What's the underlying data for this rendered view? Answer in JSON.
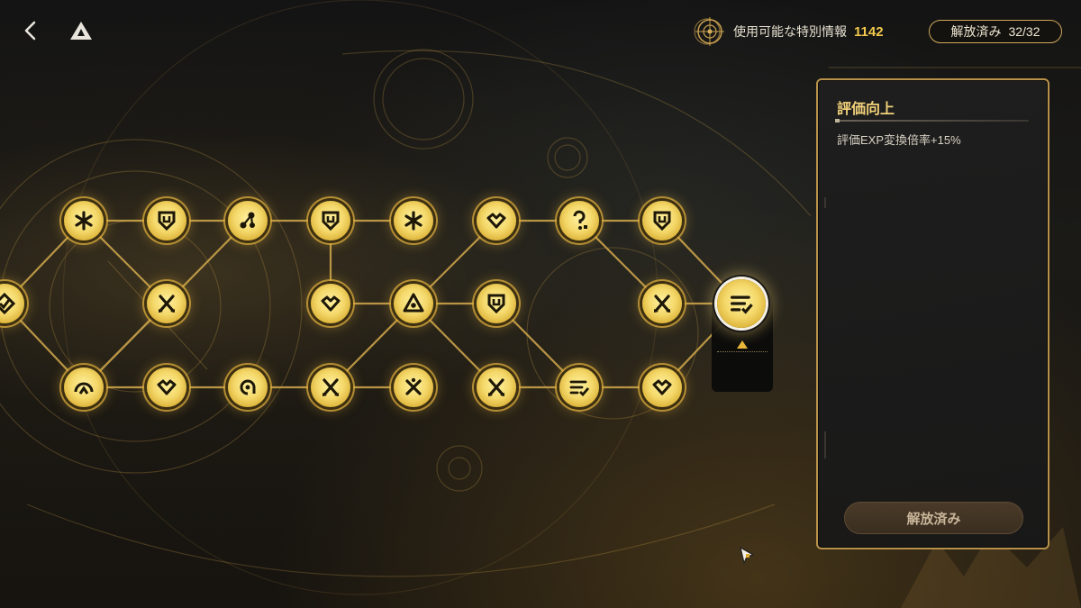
{
  "header": {
    "intel_label": "使用可能な特別情報",
    "intel_value": "1142",
    "unlocked_label": "解放済み",
    "unlocked_count": "32/32"
  },
  "panel": {
    "title": "評価向上",
    "description": "評価EXP変換倍率+15%",
    "button_label": "解放済み"
  },
  "nodes": [
    {
      "id": "n0",
      "icon": "diamond-check-icon"
    },
    {
      "id": "n1",
      "icon": "asterisk-icon"
    },
    {
      "id": "n2",
      "icon": "shield-u-icon"
    },
    {
      "id": "n3",
      "icon": "cross-arrows-icon"
    },
    {
      "id": "n4",
      "icon": "dome-up-icon"
    },
    {
      "id": "n5",
      "icon": "heart-check-icon"
    },
    {
      "id": "n6",
      "icon": "molecule-icon"
    },
    {
      "id": "n7",
      "icon": "circle-a-icon"
    },
    {
      "id": "n8",
      "icon": "shield-u-icon"
    },
    {
      "id": "n9",
      "icon": "heart-check-icon"
    },
    {
      "id": "n10",
      "icon": "cross-arrows-icon"
    },
    {
      "id": "n11",
      "icon": "asterisk-icon"
    },
    {
      "id": "n12",
      "icon": "triangle-eye-icon"
    },
    {
      "id": "n13",
      "icon": "x-split-icon"
    },
    {
      "id": "n14",
      "icon": "heart-check-icon"
    },
    {
      "id": "n15",
      "icon": "shield-u-icon"
    },
    {
      "id": "n16",
      "icon": "cross-arrows-icon"
    },
    {
      "id": "n17",
      "icon": "question-icon"
    },
    {
      "id": "n18",
      "icon": "list-check-icon"
    },
    {
      "id": "n19",
      "icon": "shield-u-icon"
    },
    {
      "id": "n20",
      "icon": "cross-arrows-icon"
    },
    {
      "id": "n21",
      "icon": "heart-check-icon"
    },
    {
      "id": "n22",
      "icon": "list-check-icon",
      "selected": true
    }
  ],
  "colors": {
    "accent_gold": "#f2c94c",
    "node_gold": "#f4d86a",
    "panel_border": "#b8924a"
  }
}
